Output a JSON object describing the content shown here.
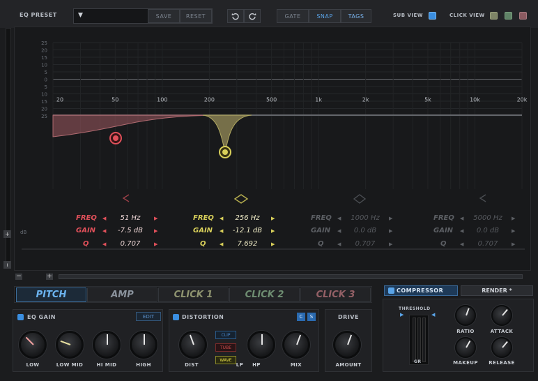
{
  "toolbar": {
    "preset_label": "EQ PRESET",
    "dropdown_arrow": "▼",
    "save": "SAVE",
    "reset": "RESET",
    "undo_icon": "undo-icon",
    "redo_icon": "redo-icon",
    "gate": "GATE",
    "snap": "SNAP",
    "tags": "TAGS",
    "sub_view": "SUB VIEW",
    "click_view": "CLICK VIEW"
  },
  "eq": {
    "y_labels": [
      "25",
      "20",
      "15",
      "10",
      "5",
      "0",
      "5",
      "10",
      "15",
      "20",
      "25"
    ],
    "x_labels": [
      "20",
      "50",
      "100",
      "200",
      "500",
      "1k",
      "2k",
      "5k",
      "10k",
      "20k"
    ],
    "db_label": "dB",
    "bands": [
      {
        "freq_label": "FREQ",
        "gain_label": "GAIN",
        "q_label": "Q",
        "freq": "51 Hz",
        "gain": "-7.5 dB",
        "q": "0.707",
        "color": "#e0505a",
        "active": true
      },
      {
        "freq_label": "FREQ",
        "gain_label": "GAIN",
        "q_label": "Q",
        "freq": "256 Hz",
        "gain": "-12.1 dB",
        "q": "7.692",
        "color": "#d8cf5a",
        "active": true
      },
      {
        "freq_label": "FREQ",
        "gain_label": "GAIN",
        "q_label": "Q",
        "freq": "1000 Hz",
        "gain": "0.0 dB",
        "q": "0.707",
        "color": "#5c5f64",
        "active": false
      },
      {
        "freq_label": "FREQ",
        "gain_label": "GAIN",
        "q_label": "Q",
        "freq": "5000 Hz",
        "gain": "0.0 dB",
        "q": "0.707",
        "color": "#5c5f64",
        "active": false
      }
    ]
  },
  "zoom": {
    "minus": "−",
    "plus": "+"
  },
  "tabs": [
    "PITCH",
    "AMP",
    "CLICK 1",
    "CLICK 2",
    "CLICK 3"
  ],
  "eq_gain": {
    "title": "EQ GAIN",
    "edit": "EDIT",
    "knobs": [
      "LOW",
      "LOW MID",
      "HI MID",
      "HIGH"
    ]
  },
  "distortion": {
    "title": "DISTORTION",
    "c": "C",
    "s": "S",
    "modes": [
      "CLIP",
      "TUBE",
      "WAVE"
    ],
    "knobs": [
      "DIST",
      "LP",
      "HP",
      "MIX"
    ]
  },
  "drive": {
    "title": "DRIVE",
    "knob": "AMOUNT"
  },
  "compressor": {
    "title": "COMPRESSOR",
    "render": "RENDER *",
    "threshold": "THRESHOLD",
    "gr": "GR",
    "knobs": [
      "RATIO",
      "ATTACK",
      "MAKEUP",
      "RELEASE"
    ]
  },
  "colors": {
    "accent": "#5aa4e8",
    "band1": "#e0505a",
    "band2": "#d8cf5a"
  }
}
